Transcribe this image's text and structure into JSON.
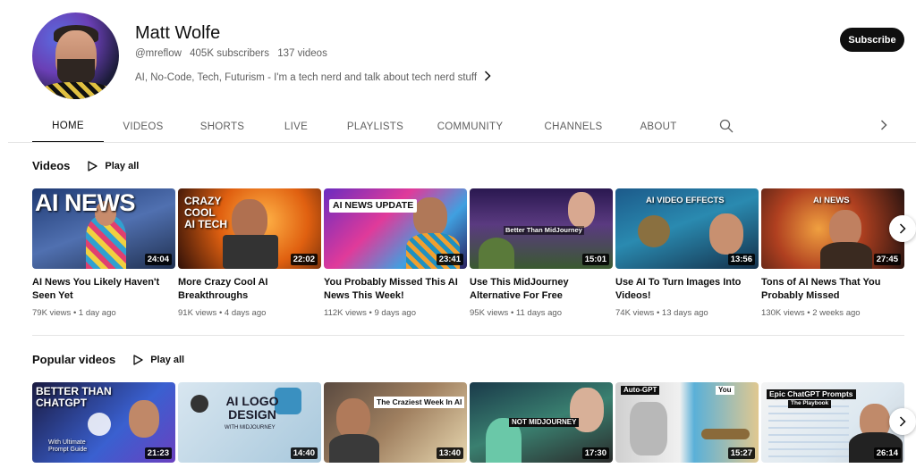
{
  "channel": {
    "name": "Matt Wolfe",
    "handle": "@mreflow",
    "subscribers": "405K subscribers",
    "videos_count": "137 videos",
    "description": "AI, No-Code, Tech, Futurism - I'm a tech nerd and talk about tech nerd stuff",
    "subscribe_label": "Subscribe"
  },
  "tabs": [
    {
      "label": "HOME",
      "active": true
    },
    {
      "label": "VIDEOS"
    },
    {
      "label": "SHORTS"
    },
    {
      "label": "LIVE"
    },
    {
      "label": "PLAYLISTS"
    },
    {
      "label": "COMMUNITY"
    },
    {
      "label": "CHANNELS"
    },
    {
      "label": "ABOUT"
    }
  ],
  "icons": {
    "search": "search-icon",
    "tabs_next": "chevron-right-icon",
    "description_more": "chevron-right-icon",
    "play_all": "play-icon",
    "row_next": "chevron-right-icon"
  },
  "sections": [
    {
      "title": "Videos",
      "play_all": "Play all",
      "videos": [
        {
          "thumb_text": "AI NEWS",
          "duration": "24:04",
          "title": "AI News You Likely Haven't Seen Yet",
          "views": "79K views",
          "age": "1 day ago"
        },
        {
          "thumb_text": "CRAZY COOL AI TECH",
          "duration": "22:02",
          "title": "More Crazy Cool AI Breakthroughs",
          "views": "91K views",
          "age": "4 days ago"
        },
        {
          "thumb_text": "AI NEWS UPDATE",
          "duration": "23:41",
          "title": "You Probably Missed This AI News This Week!",
          "views": "112K views",
          "age": "9 days ago"
        },
        {
          "thumb_text": "Better Than MidJourney",
          "duration": "15:01",
          "title": "Use This MidJourney Alternative For Free",
          "views": "95K views",
          "age": "11 days ago"
        },
        {
          "thumb_text": "AI VIDEO EFFECTS",
          "duration": "13:56",
          "title": "Use AI To Turn Images Into Videos!",
          "views": "74K views",
          "age": "13 days ago"
        },
        {
          "thumb_text": "AI NEWS",
          "duration": "27:45",
          "title": "Tons of AI News That You Probably Missed",
          "views": "130K views",
          "age": "2 weeks ago"
        }
      ]
    },
    {
      "title": "Popular videos",
      "play_all": "Play all",
      "videos": [
        {
          "thumb_text": "BETTER THAN CHATGPT",
          "thumb_sub": "With Ultimate Prompt Guide",
          "duration": "21:23"
        },
        {
          "thumb_text": "AI LOGO DESIGN",
          "thumb_sub": "WITH MIDJOURNEY",
          "duration": "14:40"
        },
        {
          "thumb_text": "The Craziest Week In AI",
          "duration": "13:40"
        },
        {
          "thumb_text": "NOT MIDJOURNEY",
          "duration": "17:30"
        },
        {
          "thumb_text": "Auto-GPT",
          "thumb_sub": "You",
          "duration": "15:27"
        },
        {
          "thumb_text": "Epic ChatGPT Prompts",
          "thumb_sub": "The Playbook",
          "duration": "26:14"
        }
      ]
    }
  ]
}
